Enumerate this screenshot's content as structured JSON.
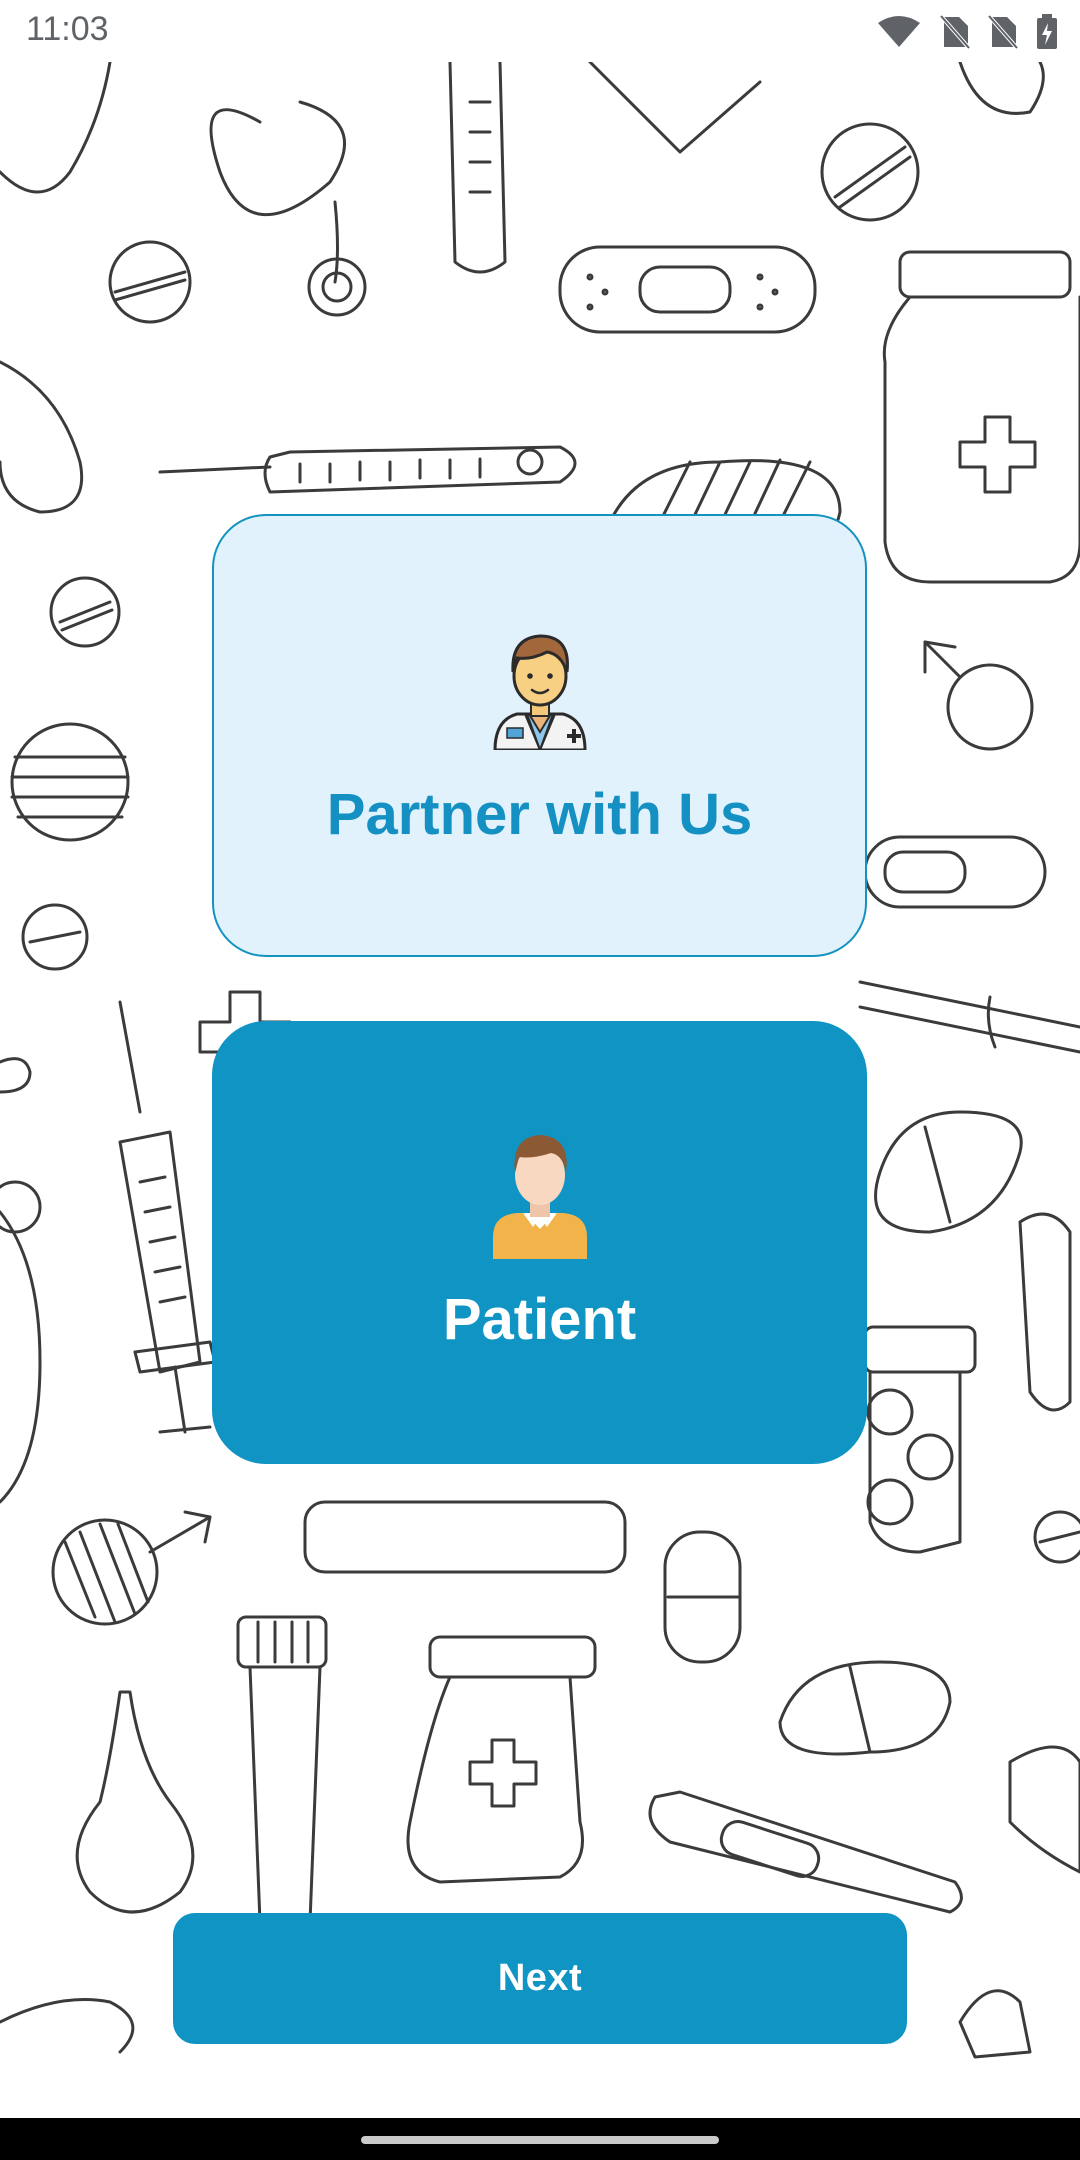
{
  "status_bar": {
    "time": "11:03",
    "icons": [
      "wifi-icon",
      "no-sim-icon",
      "no-sim-icon",
      "battery-charging-icon"
    ]
  },
  "background": {
    "pattern": "medical doodle outline illustrations"
  },
  "roles": [
    {
      "label": "Partner with Us",
      "icon": "doctor-icon",
      "selected": false
    },
    {
      "label": "Patient",
      "icon": "patient-icon",
      "selected": true
    }
  ],
  "actions": {
    "next_label": "Next"
  },
  "colors": {
    "accent": "#0f94c4",
    "card_light": "#e2f2fc",
    "partner_text": "#1590c2"
  }
}
